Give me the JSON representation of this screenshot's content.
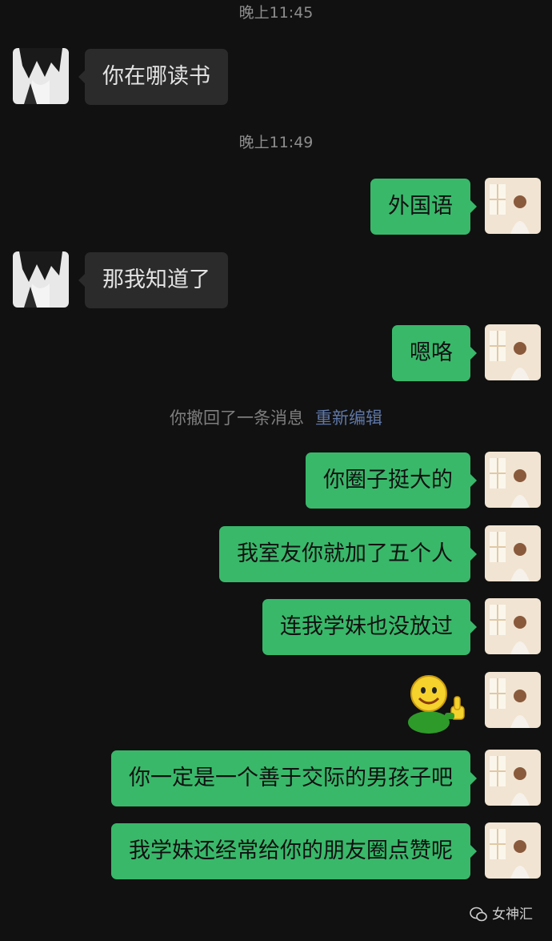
{
  "timestamps": [
    "晚上11:45",
    "晚上11:49"
  ],
  "messages": [
    {
      "side": "in",
      "text": "你在哪读书"
    },
    {
      "side": "out",
      "text": "外国语"
    },
    {
      "side": "in",
      "text": "那我知道了"
    },
    {
      "side": "out",
      "text": "嗯咯"
    },
    {
      "side": "out",
      "text": "你圈子挺大的"
    },
    {
      "side": "out",
      "text": "我室友你就加了五个人"
    },
    {
      "side": "out",
      "text": "连我学妹也没放过"
    },
    {
      "side": "out",
      "sticker": "thumbs-up-smiley-icon"
    },
    {
      "side": "out",
      "text": "你一定是一个善于交际的男孩子吧"
    },
    {
      "side": "out",
      "text": "我学妹还经常给你的朋友圈点赞呢"
    }
  ],
  "recall_notice": {
    "text": "你撤回了一条消息",
    "action": "重新编辑"
  },
  "watermark": "女神汇",
  "colors": {
    "background": "#111111",
    "outgoing_bubble": "#39b86a",
    "incoming_bubble": "#2b2b2b",
    "link": "#5f77a6"
  }
}
